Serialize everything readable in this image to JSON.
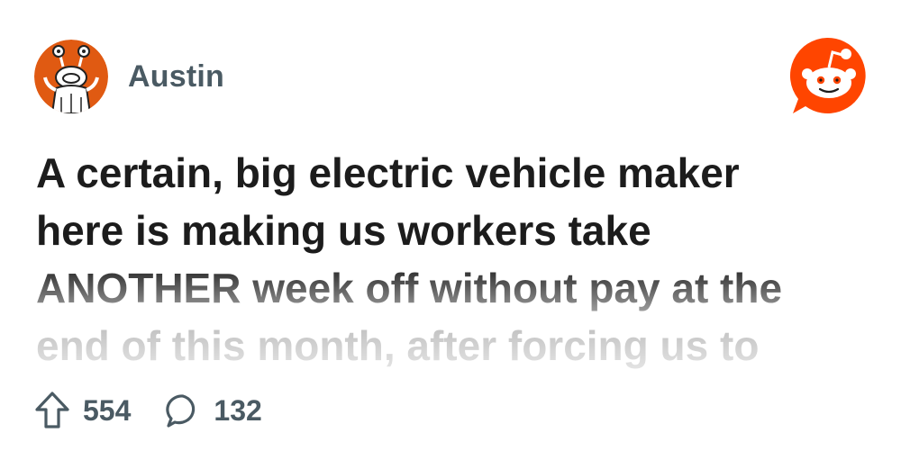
{
  "post": {
    "author": "Austin",
    "avatar_icon": "alien-robot-avatar-icon",
    "title_lines": [
      "A certain, big electric vehicle maker",
      "here is making us workers take",
      "ANOTHER week off without pay at the",
      "end of this month, after forcing us to"
    ],
    "upvotes": "554",
    "comments": "132"
  },
  "icons": {
    "upvote": "upvote-arrow-icon",
    "comment": "speech-bubble-icon",
    "brand": "reddit-logo-icon"
  },
  "colors": {
    "brand": "#ff4500",
    "avatar_bg": "#e05a12",
    "meta_text": "#4a5a63",
    "title_text": "#1c1c1c"
  }
}
